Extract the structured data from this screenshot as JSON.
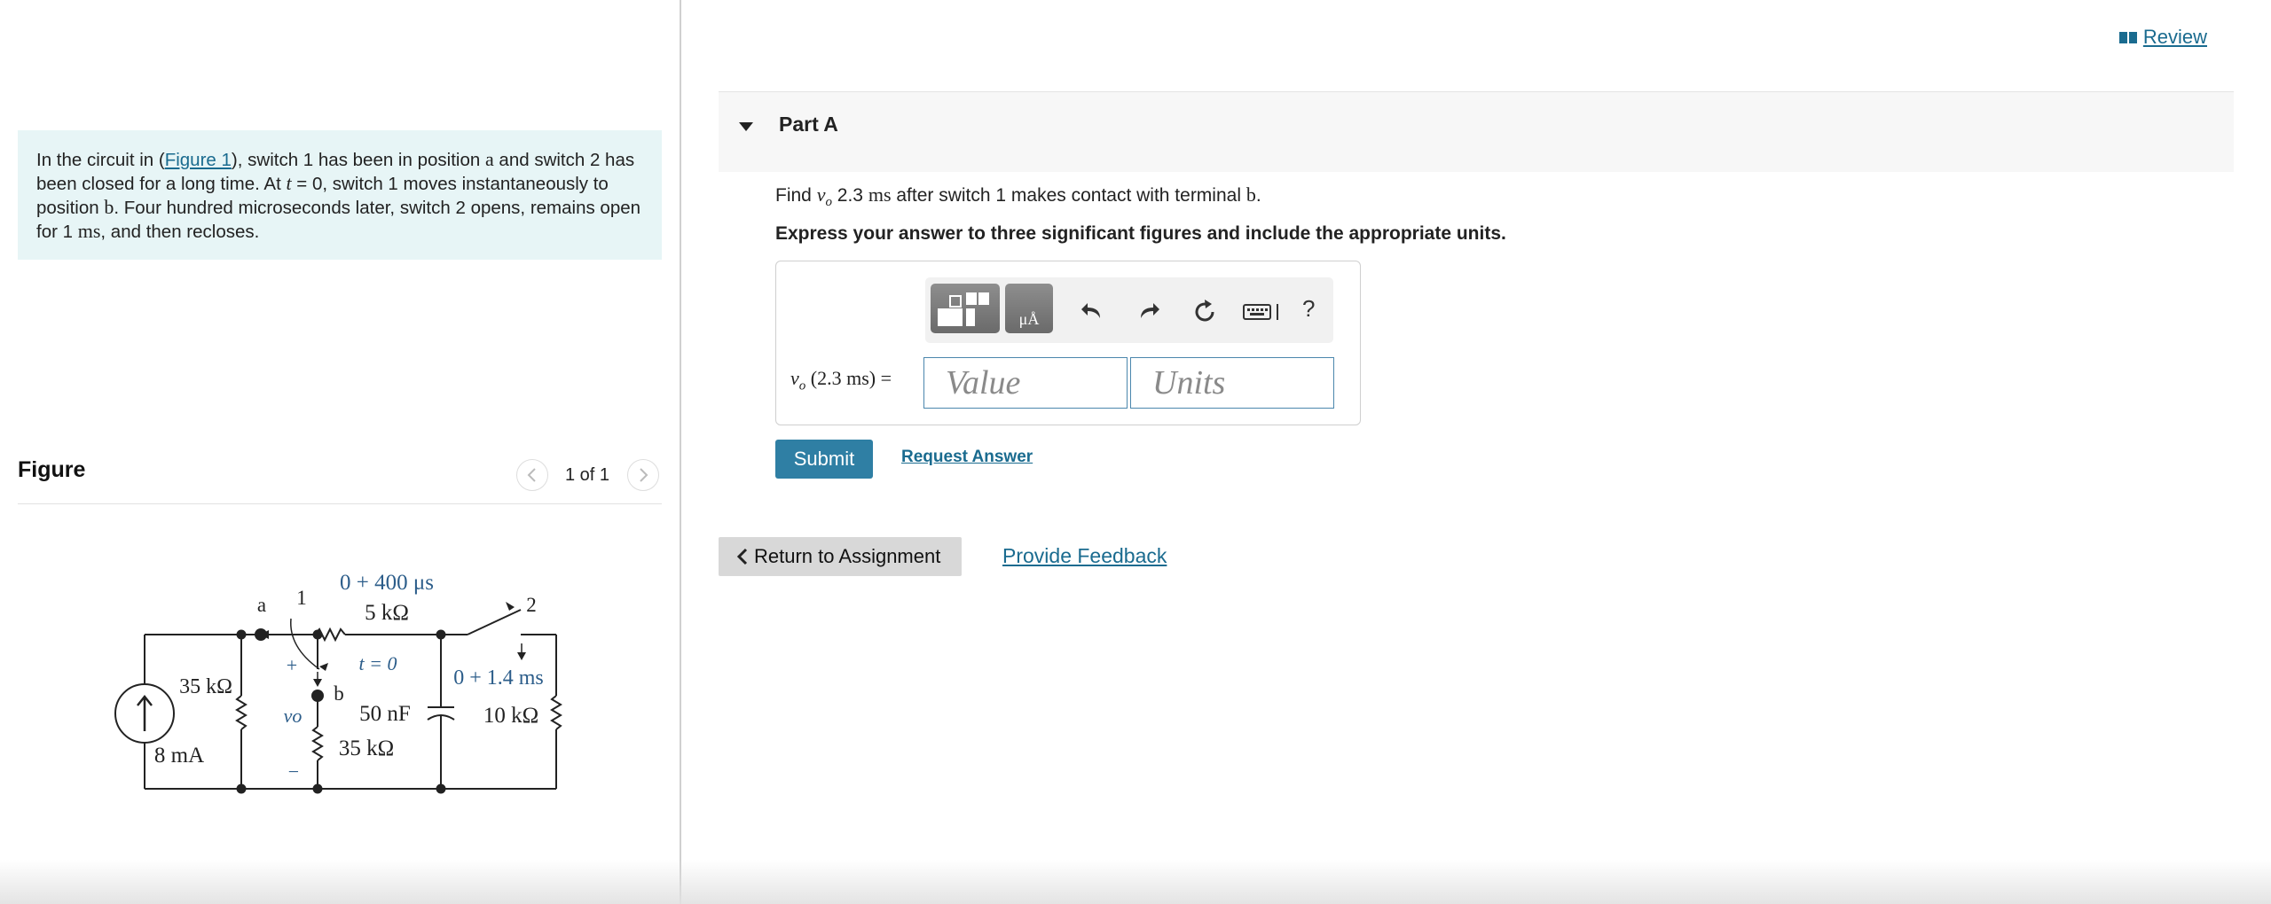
{
  "problem": {
    "t1": "In the circuit in (",
    "figure_link": "Figure 1",
    "t2": "), switch 1 has been in position ",
    "pos_a": "a",
    "t3": " and switch 2 has been closed for a long time. At ",
    "t_var": "t",
    "t4": " = 0, switch 1 moves instantaneously to position ",
    "pos_b": "b",
    "t5": ". Four hundred microseconds later, switch 2 opens, remains open for 1 ",
    "ms": "ms",
    "t6": ", and then recloses."
  },
  "figure": {
    "title": "Figure",
    "counter": "1 of 1",
    "circuit_labels": {
      "switch1_timing": "0 + 400 μs",
      "node_a": "a",
      "switch1_label": "1",
      "switch2_label": "2",
      "r_5k": "5 kΩ",
      "t_eq_0": "t = 0",
      "plus": "+",
      "minus": "−",
      "node_b": "b",
      "vo": "vo",
      "r_35k_left": "35 kΩ",
      "c_50n": "50 nF",
      "r_35k_bottom": "35 kΩ",
      "switch2_timing": "0 + 1.4 ms",
      "r_10k": "10 kΩ",
      "source": "8 mA"
    }
  },
  "header": {
    "review": "Review"
  },
  "part": {
    "title": "Part A",
    "question_pre": "Find ",
    "question_var": "v",
    "question_sub": "o",
    "question_mid": " 2.3 ",
    "question_ms": "ms",
    "question_post": " after switch 1 makes contact with terminal ",
    "question_b": "b",
    "question_end": ".",
    "instruction": "Express your answer to three significant figures and include the appropriate units.",
    "answer_label_var": "v",
    "answer_label_sub": "o",
    "answer_label_rest": " (2.3 ms) =",
    "value_placeholder": "Value",
    "units_placeholder": "Units",
    "toolbar_help": "?",
    "submit": "Submit",
    "request_answer": "Request Answer"
  },
  "footer": {
    "return": "Return to Assignment",
    "feedback": "Provide Feedback"
  },
  "colors": {
    "link": "#1a6b8f",
    "submit_bg": "#2f7fa4",
    "problem_bg": "#e7f5f6",
    "circuit_blue": "#2c5d8a"
  }
}
